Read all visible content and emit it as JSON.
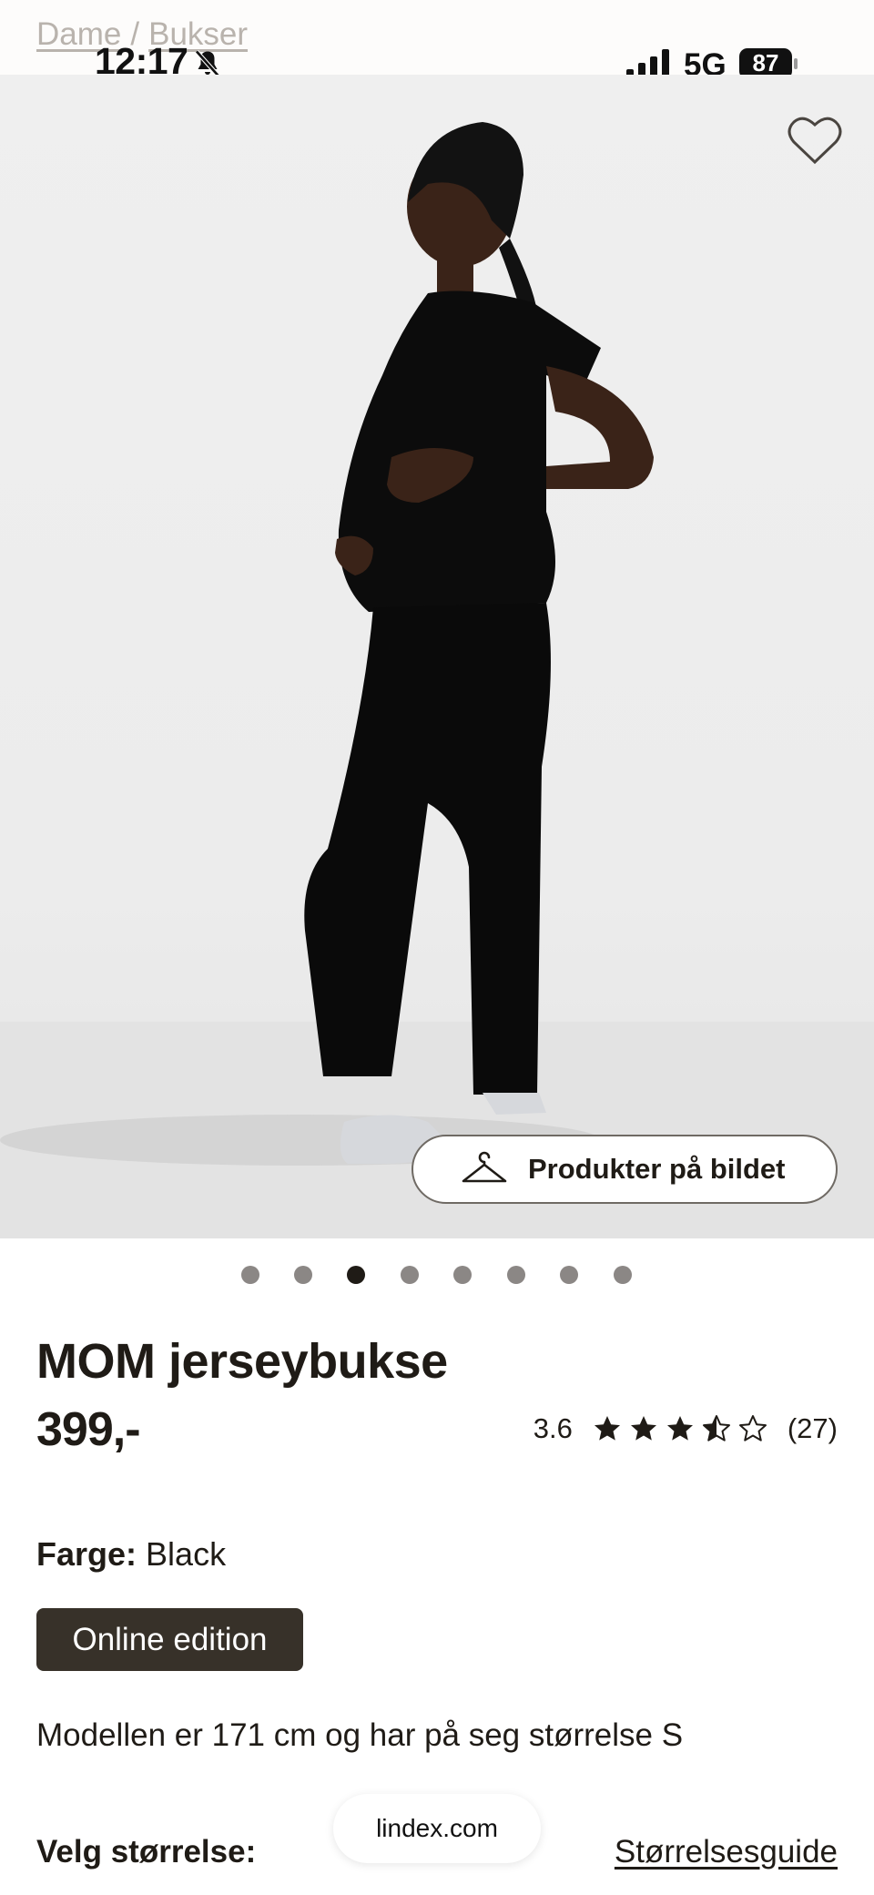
{
  "status_bar": {
    "time": "12:17",
    "network": "5G",
    "battery": "87",
    "icons": [
      "bell-muted-icon",
      "signal-icon",
      "battery-icon"
    ]
  },
  "breadcrumb": {
    "items": [
      "Dame",
      "Bukser"
    ],
    "separator": "/"
  },
  "hero": {
    "favorite_icon": "heart-outline-icon",
    "products_button_icon": "hanger-icon",
    "products_button_label": "Produkter på bildet",
    "carousel": {
      "count": 8,
      "active_index": 2
    }
  },
  "product": {
    "title": "MOM jerseybukse",
    "price": "399,-",
    "rating": {
      "score": "3.6",
      "stars_value": 3.6,
      "max_stars": 5,
      "count": "(27)"
    },
    "color_label": "Farge:",
    "color_value": "Black",
    "badge": "Online edition",
    "model_note": "Modellen er 171 cm og har på seg størrelse S",
    "size_label": "Velg størrelse:",
    "size_guide_link": "Størrelsesguide"
  },
  "browser": {
    "url": "lindex.com"
  },
  "colors": {
    "text": "#1f1b16",
    "badge_bg": "#373129",
    "breadcrumb": "#b9b3ad"
  }
}
